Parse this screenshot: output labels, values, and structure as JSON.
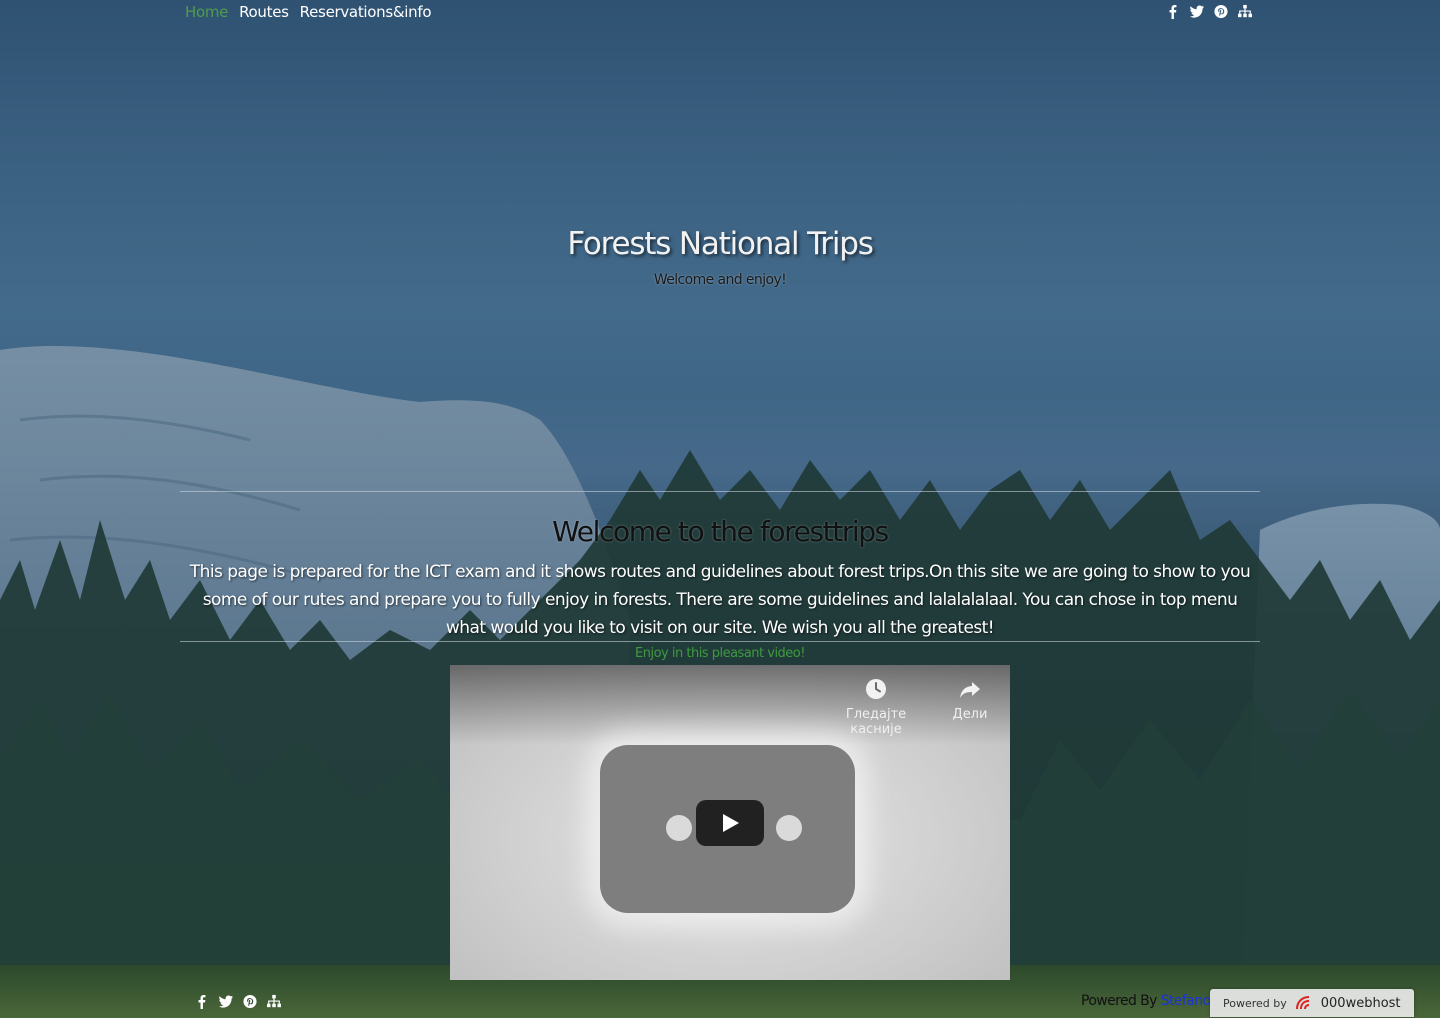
{
  "nav": {
    "items": [
      {
        "label": "Home",
        "active": true
      },
      {
        "label": "Routes",
        "active": false
      },
      {
        "label": "Reservations&info",
        "active": false
      }
    ]
  },
  "social_icons": [
    "facebook-icon",
    "twitter-icon",
    "pinterest-icon",
    "sitemap-icon"
  ],
  "hero": {
    "title": "Forests National Trips",
    "subtitle": "Welcome and enjoy!"
  },
  "welcome": {
    "title": "Welcome to the foresttrips",
    "text": "This page is prepared for the ICT exam and it shows routes and guidelines about forest trips.On this site we are going to show to you some of our rutes and prepare you to fully enjoy in forests. There are some guidelines and lalalalalaal. You can chose in top menu what would you like to visit on our site. We wish you all the greatest!"
  },
  "video": {
    "caption": "Enjoy in this pleasant video!",
    "watch_later_label": "Гледајте касније",
    "share_label": "Дели"
  },
  "footer": {
    "powered_by_prefix": "Powered By",
    "author": "Stefano",
    "host_badge_prefix": "Powered by",
    "host_badge_brand": "000webhost"
  },
  "colors": {
    "nav_active": "#4f9d4b",
    "caption_green": "#3f9a3f",
    "author_link": "#1a33d8"
  }
}
